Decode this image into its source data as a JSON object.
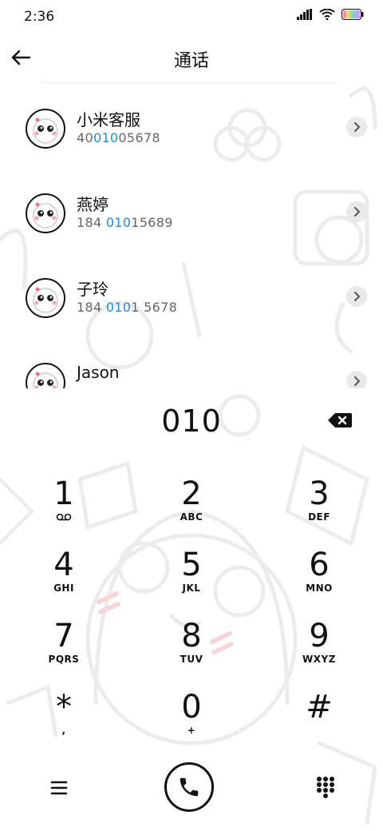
{
  "status": {
    "time": "2:36"
  },
  "header": {
    "title": "通话"
  },
  "contacts": [
    {
      "name": "小米客服",
      "num_pre": "40",
      "num_hl": "010",
      "num_post": "05678"
    },
    {
      "name": "燕婷",
      "num_pre": "184 ",
      "num_hl": "010",
      "num_post": "15689"
    },
    {
      "name": "子玲",
      "num_pre": "184 ",
      "num_hl": "010",
      "num_post": "1 5678"
    },
    {
      "name": "Jason",
      "num_pre": "",
      "num_hl": "",
      "num_post": ""
    }
  ],
  "dialer": {
    "number": "010",
    "keys": [
      {
        "digit": "1",
        "letters": ""
      },
      {
        "digit": "2",
        "letters": "ABC"
      },
      {
        "digit": "3",
        "letters": "DEF"
      },
      {
        "digit": "4",
        "letters": "GHI"
      },
      {
        "digit": "5",
        "letters": "JKL"
      },
      {
        "digit": "6",
        "letters": "MNO"
      },
      {
        "digit": "7",
        "letters": "PQRS"
      },
      {
        "digit": "8",
        "letters": "TUV"
      },
      {
        "digit": "9",
        "letters": "WXYZ"
      },
      {
        "digit": "*",
        "letters": ","
      },
      {
        "digit": "0",
        "letters": "+"
      },
      {
        "digit": "#",
        "letters": ""
      }
    ]
  },
  "icons": {
    "back": "arrow-left-icon",
    "delete": "backspace-icon",
    "menu": "menu-icon",
    "call": "phone-icon",
    "keypad": "keypad-icon",
    "voicemail": "voicemail-icon"
  },
  "colors": {
    "highlight": "#1a8cdc"
  }
}
